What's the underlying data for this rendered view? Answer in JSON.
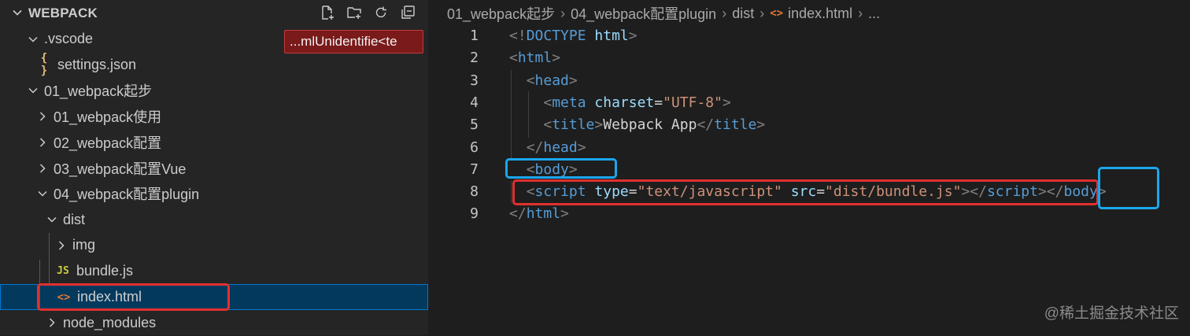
{
  "explorer": {
    "title": "WEBPACK",
    "actions": [
      "new-file-icon",
      "new-folder-icon",
      "refresh-icon",
      "collapse-all-icon"
    ],
    "error_badge": "...mlUnidentifie<te",
    "items": [
      {
        "label": ".vscode",
        "type": "folder",
        "expanded": true,
        "depth": 1
      },
      {
        "label": "settings.json",
        "type": "json",
        "icon": "{ }",
        "depth": 2
      },
      {
        "label": "01_webpack起步",
        "type": "folder",
        "expanded": true,
        "depth": 1
      },
      {
        "label": "01_webpack使用",
        "type": "folder",
        "expanded": false,
        "depth": 2
      },
      {
        "label": "02_webpack配置",
        "type": "folder",
        "expanded": false,
        "depth": 2
      },
      {
        "label": "03_webpack配置Vue",
        "type": "folder",
        "expanded": false,
        "depth": 2
      },
      {
        "label": "04_webpack配置plugin",
        "type": "folder",
        "expanded": true,
        "depth": 2
      },
      {
        "label": "dist",
        "type": "folder",
        "expanded": true,
        "depth": 3
      },
      {
        "label": "img",
        "type": "folder",
        "expanded": false,
        "depth": 4
      },
      {
        "label": "bundle.js",
        "type": "js",
        "icon": "JS",
        "depth": 4
      },
      {
        "label": "index.html",
        "type": "html",
        "icon": "<>",
        "depth": 4,
        "selected": true
      },
      {
        "label": "node_modules",
        "type": "folder",
        "expanded": false,
        "depth": 3
      }
    ]
  },
  "breadcrumb": {
    "parts": [
      "01_webpack起步",
      "04_webpack配置plugin",
      "dist",
      "index.html",
      "..."
    ],
    "file_icon": "<>"
  },
  "code": {
    "line_numbers": [
      "1",
      "2",
      "3",
      "4",
      "5",
      "6",
      "7",
      "8",
      "9"
    ],
    "lines": [
      [
        [
          "punct",
          "<!"
        ],
        [
          "tag",
          "DOCTYPE"
        ],
        [
          "text",
          " "
        ],
        [
          "attr",
          "html"
        ],
        [
          "punct",
          ">"
        ]
      ],
      [
        [
          "punct",
          "<"
        ],
        [
          "tag",
          "html"
        ],
        [
          "punct",
          ">"
        ]
      ],
      [
        [
          "text",
          "  "
        ],
        [
          "punct",
          "<"
        ],
        [
          "tag",
          "head"
        ],
        [
          "punct",
          ">"
        ]
      ],
      [
        [
          "text",
          "    "
        ],
        [
          "punct",
          "<"
        ],
        [
          "tag",
          "meta"
        ],
        [
          "text",
          " "
        ],
        [
          "attr",
          "charset"
        ],
        [
          "eq",
          "="
        ],
        [
          "str",
          "\"UTF-8\""
        ],
        [
          "punct",
          ">"
        ]
      ],
      [
        [
          "text",
          "    "
        ],
        [
          "punct",
          "<"
        ],
        [
          "tag",
          "title"
        ],
        [
          "punct",
          ">"
        ],
        [
          "text",
          "Webpack App"
        ],
        [
          "punct",
          "</"
        ],
        [
          "tag",
          "title"
        ],
        [
          "punct",
          ">"
        ]
      ],
      [
        [
          "text",
          "  "
        ],
        [
          "punct",
          "</"
        ],
        [
          "tag",
          "head"
        ],
        [
          "punct",
          ">"
        ]
      ],
      [
        [
          "text",
          "  "
        ],
        [
          "punct",
          "<"
        ],
        [
          "tag",
          "body"
        ],
        [
          "punct",
          ">"
        ]
      ],
      [
        [
          "text",
          "  "
        ],
        [
          "punct",
          "<"
        ],
        [
          "tag",
          "script"
        ],
        [
          "text",
          " "
        ],
        [
          "attr",
          "type"
        ],
        [
          "eq",
          "="
        ],
        [
          "str",
          "\"text/javascript\""
        ],
        [
          "text",
          " "
        ],
        [
          "attr",
          "src"
        ],
        [
          "eq",
          "="
        ],
        [
          "str",
          "\"dist/bundle.js\""
        ],
        [
          "punct",
          "></"
        ],
        [
          "tag",
          "script"
        ],
        [
          "punct",
          "></"
        ],
        [
          "tag",
          "body"
        ],
        [
          "punct",
          ">"
        ]
      ],
      [
        [
          "punct",
          "</"
        ],
        [
          "tag",
          "html"
        ],
        [
          "punct",
          ">"
        ]
      ]
    ]
  },
  "colors": {
    "tag": "#569cd6",
    "attr": "#9cdcfe",
    "string": "#ce9178",
    "highlight_red": "#e03030",
    "highlight_blue": "#1aa7ec",
    "selection": "#04395e"
  },
  "watermark": "@稀土掘金技术社区"
}
